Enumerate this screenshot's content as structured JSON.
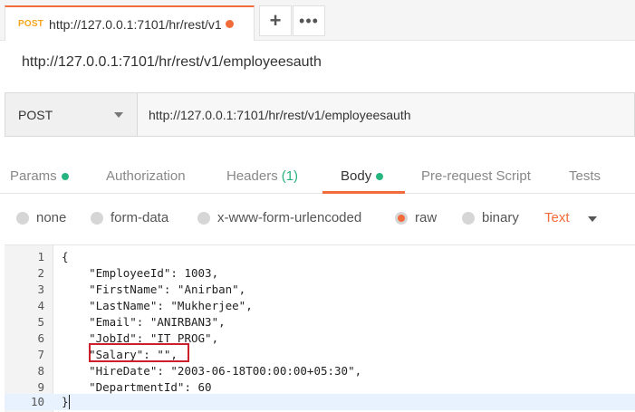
{
  "tab": {
    "method": "POST",
    "url": "http://127.0.0.1:7101/hr/rest/v1",
    "add_symbol": "+",
    "more_symbol": "•••"
  },
  "request": {
    "title": "http://127.0.0.1:7101/hr/rest/v1/employeesauth",
    "method": "POST",
    "url": "http://127.0.0.1:7101/hr/rest/v1/employeesauth"
  },
  "request_tabs": [
    {
      "label": "Params",
      "dot": true
    },
    {
      "label": "Authorization"
    },
    {
      "label": "Headers",
      "count": "(1)"
    },
    {
      "label": "Body",
      "dot": true,
      "active": true
    },
    {
      "label": "Pre-request Script"
    },
    {
      "label": "Tests"
    }
  ],
  "body_options": [
    {
      "label": "none"
    },
    {
      "label": "form-data"
    },
    {
      "label": "x-www-form-urlencoded"
    },
    {
      "label": "raw",
      "selected": true
    },
    {
      "label": "binary"
    }
  ],
  "body_language": "Text",
  "editor": {
    "lines": [
      {
        "n": "1",
        "text": "{"
      },
      {
        "n": "2",
        "text": "    \"EmployeeId\": 1003,"
      },
      {
        "n": "3",
        "text": "    \"FirstName\": \"Anirban\","
      },
      {
        "n": "4",
        "text": "    \"LastName\": \"Mukherjee\","
      },
      {
        "n": "5",
        "text": "    \"Email\": \"ANIRBAN3\","
      },
      {
        "n": "6",
        "text": "    \"JobId\": \"IT_PROG\","
      },
      {
        "n": "7",
        "text": "    \"Salary\": \"\","
      },
      {
        "n": "8",
        "text": "    \"HireDate\": \"2003-06-18T00:00:00+05:30\","
      },
      {
        "n": "9",
        "text": "    \"DepartmentId\": 60"
      },
      {
        "n": "10",
        "text": "}"
      }
    ]
  },
  "colors": {
    "accent": "#f26b3a",
    "method_post": "#f4a51c",
    "status_green": "#26b47f",
    "highlight": "#cc1f2b"
  }
}
